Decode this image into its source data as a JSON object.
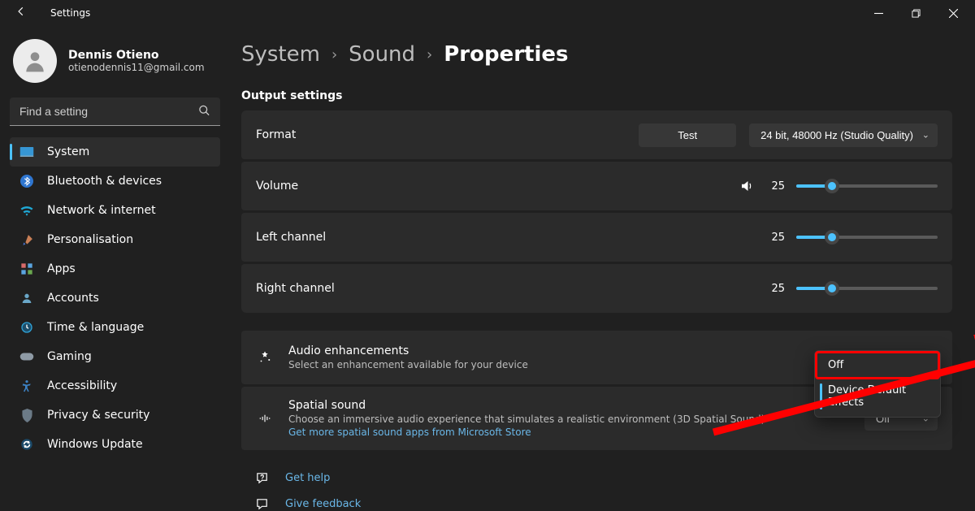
{
  "titlebar": {
    "title": "Settings"
  },
  "user": {
    "name": "Dennis Otieno",
    "email": "otienodennis11@gmail.com"
  },
  "search": {
    "placeholder": "Find a setting"
  },
  "sidebar": {
    "items": [
      {
        "label": "System"
      },
      {
        "label": "Bluetooth & devices"
      },
      {
        "label": "Network & internet"
      },
      {
        "label": "Personalisation"
      },
      {
        "label": "Apps"
      },
      {
        "label": "Accounts"
      },
      {
        "label": "Time & language"
      },
      {
        "label": "Gaming"
      },
      {
        "label": "Accessibility"
      },
      {
        "label": "Privacy & security"
      },
      {
        "label": "Windows Update"
      }
    ]
  },
  "breadcrumb": {
    "root": "System",
    "mid": "Sound",
    "current": "Properties"
  },
  "section": {
    "output_label": "Output settings"
  },
  "format": {
    "label": "Format",
    "test_btn": "Test",
    "selected": "24 bit, 48000 Hz (Studio Quality)"
  },
  "volume": {
    "label": "Volume",
    "value": "25",
    "pct": 25
  },
  "left": {
    "label": "Left channel",
    "value": "25",
    "pct": 25
  },
  "right": {
    "label": "Right channel",
    "value": "25",
    "pct": 25
  },
  "audio_enh": {
    "title": "Audio enhancements",
    "sub": "Select an enhancement available for your device"
  },
  "menu": {
    "off": "Off",
    "default": "Device Default Effects"
  },
  "spatial": {
    "title": "Spatial sound",
    "sub": "Choose an immersive audio experience that simulates a realistic environment (3D Spatial Sound)",
    "link": "Get more spatial sound apps from Microsoft Store",
    "selected": "Off"
  },
  "footer": {
    "help": "Get help",
    "feedback": "Give feedback"
  }
}
